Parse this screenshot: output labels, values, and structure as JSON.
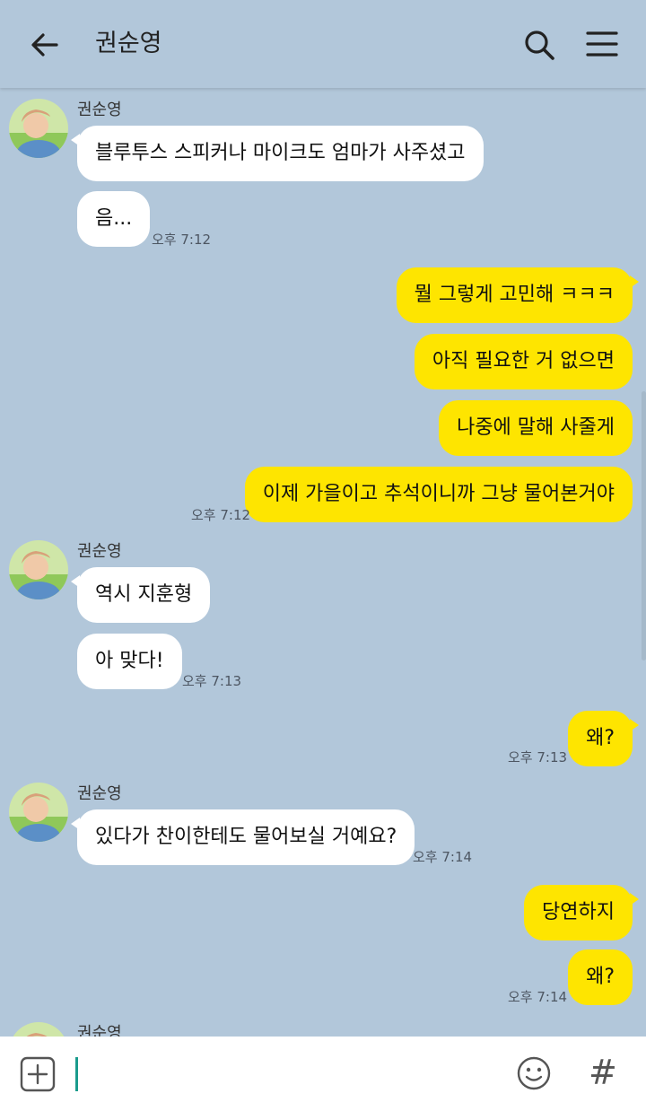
{
  "header": {
    "title": "권순영",
    "back_icon": "arrow-left-icon",
    "search_icon": "search-icon",
    "menu_icon": "hamburger-menu-icon"
  },
  "colors": {
    "background": "#b2c7da",
    "incoming_bubble": "#ffffff",
    "outgoing_bubble": "#fee500",
    "cursor": "#1a9b8c"
  },
  "messages": [
    {
      "sender": "권순영",
      "text": "블루투스 스피커나 마이크도 엄마가 사주셨고",
      "direction": "in"
    },
    {
      "text": "음...",
      "direction": "in",
      "time": "오후 7:12"
    },
    {
      "text": "뭘 그렇게 고민해 ㅋㅋㅋ",
      "direction": "out"
    },
    {
      "text": "아직 필요한 거 없으면",
      "direction": "out"
    },
    {
      "text": "나중에 말해 사줄게",
      "direction": "out"
    },
    {
      "text": "이제 가을이고 추석이니까 그냥 물어본거야",
      "direction": "out",
      "time": "오후 7:12"
    },
    {
      "sender": "권순영",
      "text": "역시 지훈형",
      "direction": "in"
    },
    {
      "text": "아 맞다!",
      "direction": "in",
      "time": "오후 7:13"
    },
    {
      "text": "왜?",
      "direction": "out",
      "time": "오후 7:13"
    },
    {
      "sender": "권순영",
      "text": "있다가 찬이한테도 물어보실 거예요?",
      "direction": "in",
      "time": "오후 7:14"
    },
    {
      "text": "당연하지",
      "direction": "out"
    },
    {
      "text": "왜?",
      "direction": "out",
      "time": "오후 7:14"
    },
    {
      "sender": "권순영",
      "direction": "in"
    }
  ],
  "input_bar": {
    "add_icon": "plus-square-icon",
    "emoji_icon": "smiley-icon",
    "hashtag_icon": "hashtag-icon",
    "hashtag_glyph": "#",
    "value": ""
  }
}
